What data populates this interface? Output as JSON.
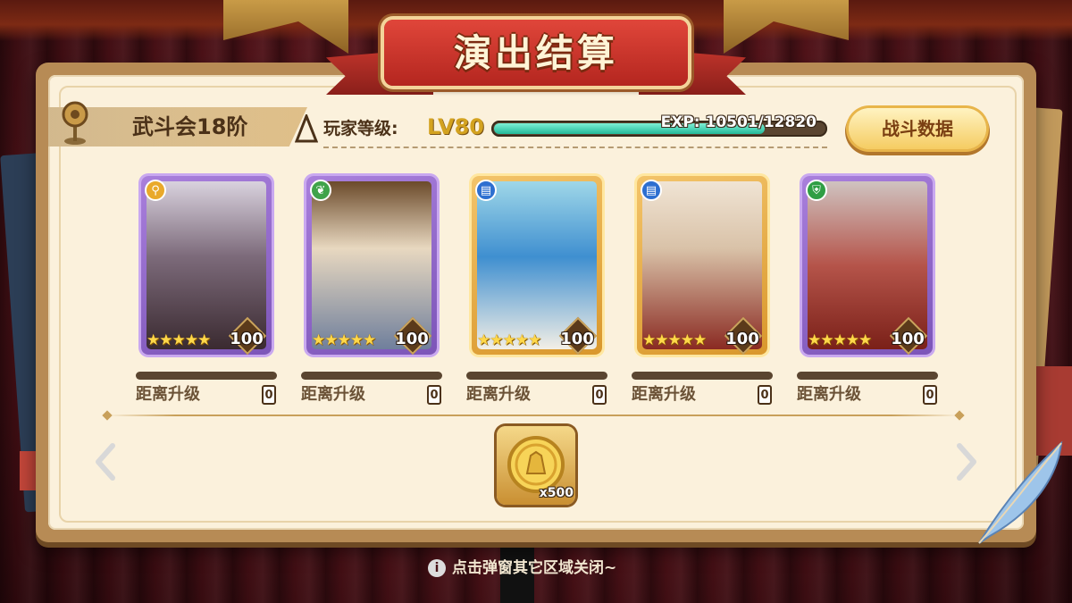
{
  "title": "演出结算",
  "stage": {
    "label": "武斗会18阶"
  },
  "player": {
    "level_label": "玩家等级:",
    "level_value": "LV80",
    "exp_text": "EXP: 10501/12820",
    "exp_current": 10501,
    "exp_max": 12820
  },
  "battle_data_button": "战斗数据",
  "characters": [
    {
      "frame": "purple",
      "role_icon": "wand-icon",
      "role_color": "#e9a92b",
      "stars": "★★★★★",
      "level": "100",
      "to_next_label": "距离升级",
      "to_next_value": "0"
    },
    {
      "frame": "purple",
      "role_icon": "leaf-icon",
      "role_color": "#3fa34a",
      "stars": "★★★★★",
      "level": "100",
      "to_next_label": "距离升级",
      "to_next_value": "0"
    },
    {
      "frame": "gold",
      "role_icon": "book-icon",
      "role_color": "#2d6fd0",
      "stars": "★★★★★",
      "level": "100",
      "to_next_label": "距离升级",
      "to_next_value": "0"
    },
    {
      "frame": "gold",
      "role_icon": "book-icon",
      "role_color": "#2d6fd0",
      "stars": "★★★★★",
      "level": "100",
      "to_next_label": "距离升级",
      "to_next_value": "0"
    },
    {
      "frame": "purple",
      "role_icon": "shield-icon",
      "role_color": "#2f9e44",
      "stars": "★★★★★",
      "level": "100",
      "to_next_label": "距离升级",
      "to_next_value": "0"
    }
  ],
  "reward": {
    "item_icon": "gold-coin-icon",
    "count": "x500"
  },
  "hint": {
    "icon": "info-icon",
    "text": "点击弹窗其它区域关闭~"
  }
}
